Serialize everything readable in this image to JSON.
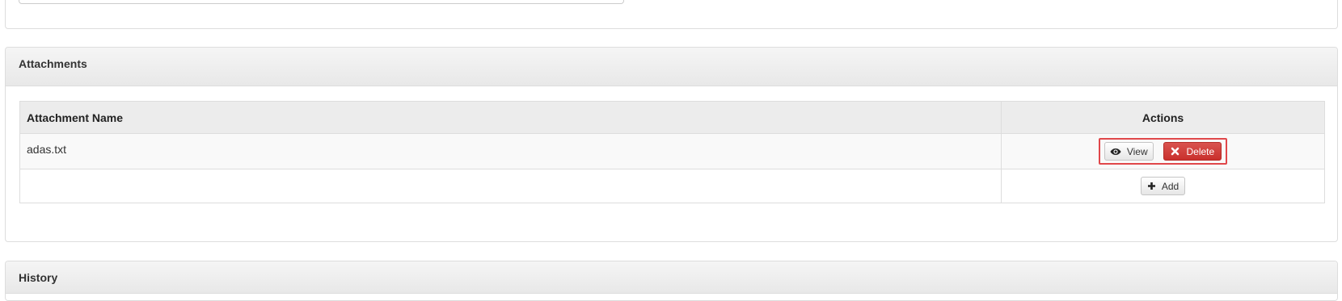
{
  "attachments": {
    "title": "Attachments",
    "columns": {
      "name": "Attachment Name",
      "actions": "Actions"
    },
    "rows": [
      {
        "name": "adas.txt",
        "view_label": "View",
        "delete_label": "Delete"
      }
    ],
    "add_label": "Add"
  },
  "history": {
    "title": "History"
  },
  "icons": {
    "view": "eye-icon",
    "delete": "close-x-icon",
    "add": "plus-icon"
  },
  "colors": {
    "danger": "#d9534f",
    "highlight": "#e0474a",
    "panel_border": "#dddddd"
  }
}
